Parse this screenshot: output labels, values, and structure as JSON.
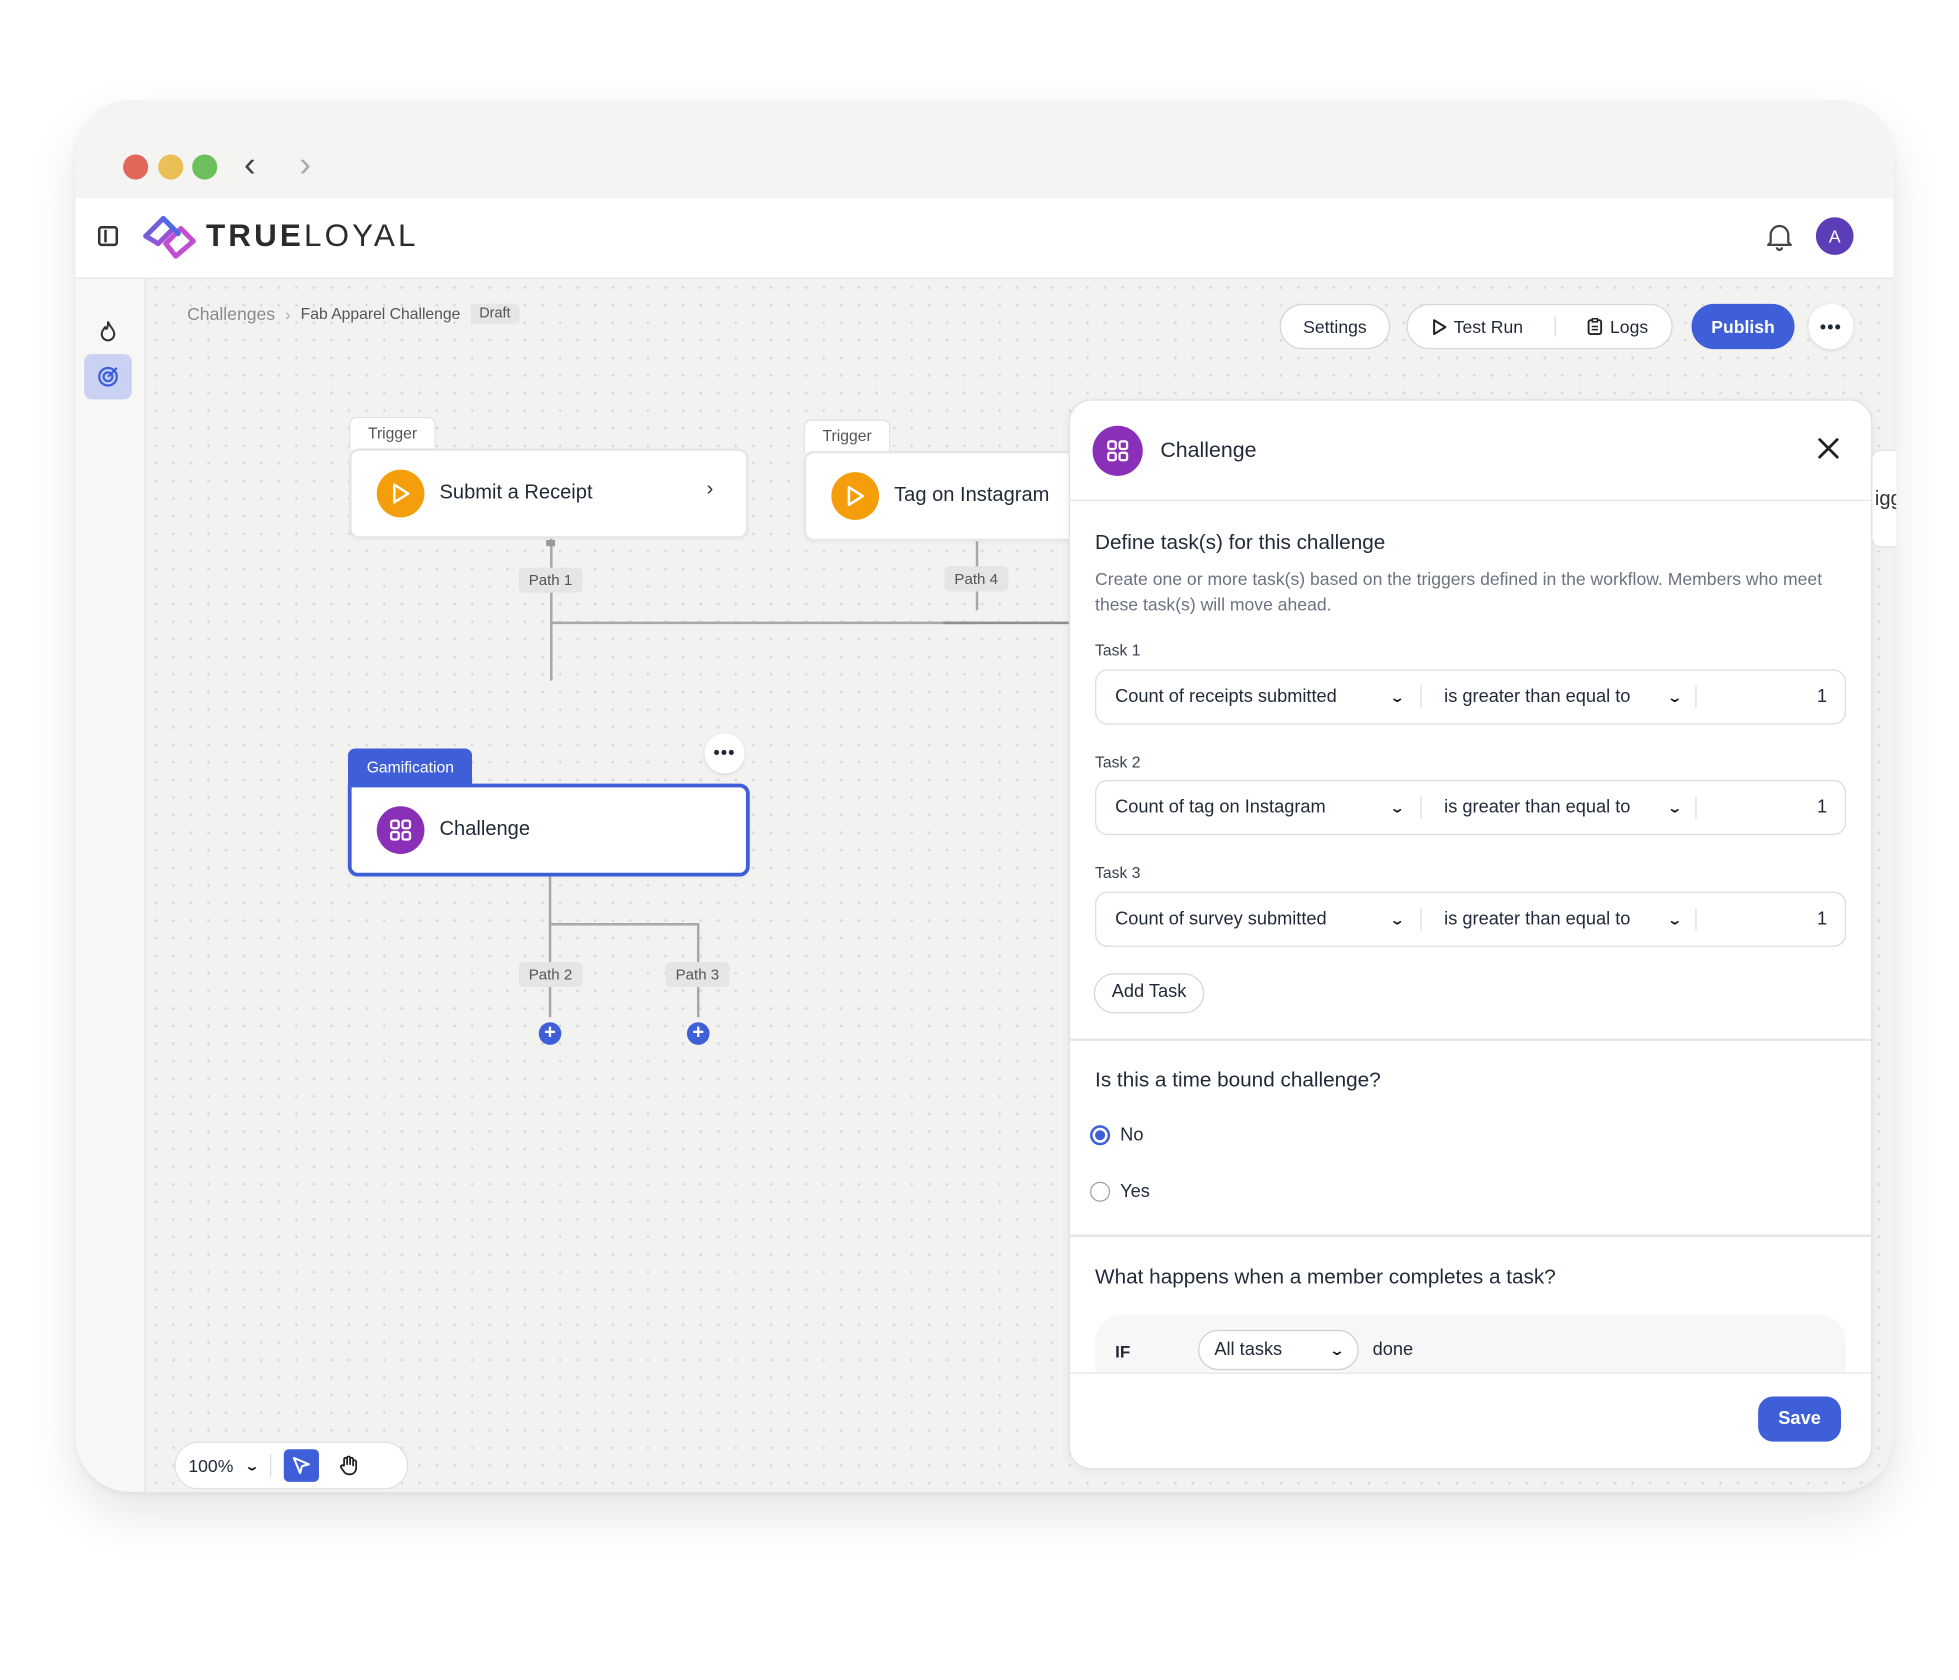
{
  "app": {
    "brand_bold": "TRUE",
    "brand_light": "LOYAL",
    "avatar_initial": "A"
  },
  "colors": {
    "accent": "#3f5fd8",
    "trigger_icon": "#f59e0b",
    "challenge_icon": "#8a2fb8"
  },
  "breadcrumb": {
    "root": "Challenges",
    "current": "Fab Apparel Challenge",
    "status": "Draft"
  },
  "toolbar": {
    "settings": "Settings",
    "test_run": "Test Run",
    "logs": "Logs",
    "publish": "Publish"
  },
  "flow": {
    "trigger_tab": "Trigger",
    "nodes": {
      "receipt": "Submit a Receipt",
      "instagram": "Tag on Instagram",
      "gamification_tab": "Gamification",
      "challenge": "Challenge"
    },
    "paths": {
      "p1": "Path 1",
      "p2": "Path 2",
      "p3": "Path 3",
      "p4": "Path 4"
    }
  },
  "zoom": {
    "level": "100%"
  },
  "panel": {
    "title": "Challenge",
    "define_title": "Define task(s) for this challenge",
    "define_desc": "Create one or more task(s) based on the triggers defined in the workflow. Members who meet these task(s) will move ahead.",
    "tasks": [
      {
        "label": "Task 1",
        "metric": "Count of receipts submitted",
        "operator": "is greater than equal to",
        "value": "1"
      },
      {
        "label": "Task 2",
        "metric": "Count of tag on Instagram",
        "operator": "is greater than equal to",
        "value": "1"
      },
      {
        "label": "Task 3",
        "metric": "Count of survey submitted",
        "operator": "is greater than equal to",
        "value": "1"
      }
    ],
    "add_task": "Add Task",
    "time_bound_title": "Is this a time bound challenge?",
    "time_bound_options": {
      "no": "No",
      "yes": "Yes",
      "selected": "No"
    },
    "completion_title": "What happens when a member completes a task?",
    "if_label": "IF",
    "if_select": "All tasks",
    "if_suffix": "done",
    "save": "Save"
  },
  "peek_text": "igg"
}
